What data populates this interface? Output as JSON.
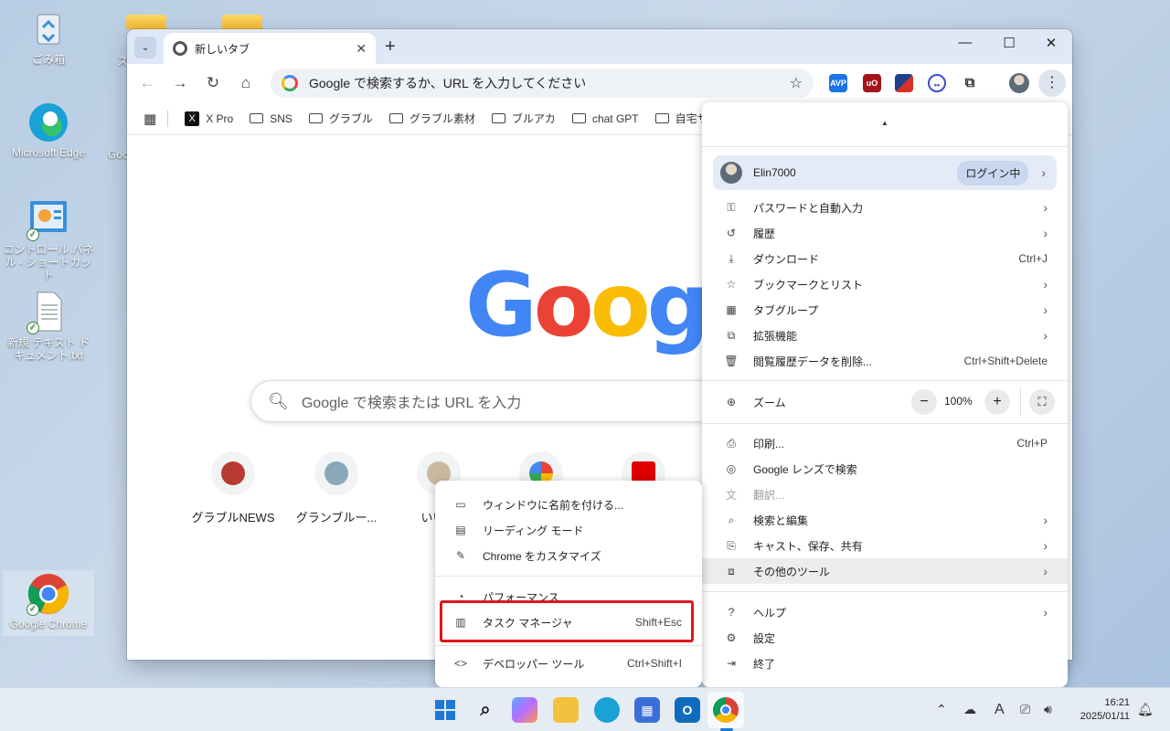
{
  "desktop": {
    "icons": [
      {
        "label": "ごみ箱",
        "icon": "recycle-bin-icon"
      },
      {
        "label": "Microsoft Edge",
        "icon": "edge-icon"
      },
      {
        "label": "コントロール パネル - ショートカット",
        "icon": "control-panel-icon"
      },
      {
        "label": "新規 テキスト ドキュメント.txt",
        "icon": "text-file-icon"
      },
      {
        "label": "Google Chrome",
        "icon": "chrome-icon"
      }
    ],
    "partial_labels": [
      "ス",
      "Goo"
    ]
  },
  "browser": {
    "tab_title": "新しいタブ",
    "omnibox_placeholder": "Google で検索するか、URL を入力してください",
    "bookmarks": [
      {
        "label": "X Pro",
        "icon": "x-icon"
      },
      {
        "label": "SNS",
        "icon": "folder-icon"
      },
      {
        "label": "グラブル",
        "icon": "folder-icon"
      },
      {
        "label": "グラブル素材",
        "icon": "folder-icon"
      },
      {
        "label": "ブルアカ",
        "icon": "folder-icon"
      },
      {
        "label": "chat GPT",
        "icon": "folder-icon"
      },
      {
        "label": "自宅サーバ",
        "icon": "folder-icon"
      }
    ],
    "extensions": [
      {
        "name": "avp-extension-icon",
        "label": "AVP",
        "color": "#1a73e8"
      },
      {
        "name": "ublock-icon",
        "label": "uO",
        "color": "#a3141a"
      },
      {
        "name": "slash-extension-icon",
        "label": "",
        "color": "#d93025"
      },
      {
        "name": "face-extension-icon",
        "label": "",
        "color": "#3c4ccf"
      }
    ]
  },
  "page": {
    "logo": "Google",
    "search_placeholder": "Google で検索または URL を入力",
    "shortcuts": [
      {
        "label": "グラブルNEWS",
        "color": "#b93a32"
      },
      {
        "label": "グランブルー...",
        "color": "#8aa9b8"
      },
      {
        "label": "いいブ",
        "color": "#c9b9a0"
      },
      {
        "label": "",
        "color": "#4285f4"
      },
      {
        "label": "",
        "color": "#e00000"
      }
    ]
  },
  "main_menu": {
    "profile_name": "Elin7000",
    "profile_status": "ログイン中",
    "items_group1": [
      {
        "label": "パスワードと自動入力",
        "icon": "key-icon",
        "shortcut": "",
        "arrow": true
      },
      {
        "label": "履歴",
        "icon": "history-icon",
        "shortcut": "",
        "arrow": true
      },
      {
        "label": "ダウンロード",
        "icon": "download-icon",
        "shortcut": "Ctrl+J",
        "arrow": false
      },
      {
        "label": "ブックマークとリスト",
        "icon": "star-icon",
        "shortcut": "",
        "arrow": true
      },
      {
        "label": "タブグループ",
        "icon": "tab-groups-icon",
        "shortcut": "",
        "arrow": true
      },
      {
        "label": "拡張機能",
        "icon": "extension-icon",
        "shortcut": "",
        "arrow": true
      },
      {
        "label": "閲覧履歴データを削除...",
        "icon": "trash-icon",
        "shortcut": "Ctrl+Shift+Delete",
        "arrow": false
      }
    ],
    "zoom_label": "ズーム",
    "zoom_value": "100%",
    "items_group2": [
      {
        "label": "印刷...",
        "icon": "print-icon",
        "shortcut": "Ctrl+P",
        "arrow": false
      },
      {
        "label": "Google レンズで検索",
        "icon": "lens-icon",
        "shortcut": "",
        "arrow": false
      },
      {
        "label": "翻訳...",
        "icon": "translate-icon",
        "shortcut": "",
        "arrow": false
      },
      {
        "label": "検索と編集",
        "icon": "find-edit-icon",
        "shortcut": "",
        "arrow": true
      },
      {
        "label": "キャスト、保存、共有",
        "icon": "cast-icon",
        "shortcut": "",
        "arrow": true
      },
      {
        "label": "その他のツール",
        "icon": "toolbox-icon",
        "shortcut": "",
        "arrow": true
      }
    ],
    "items_group3": [
      {
        "label": "ヘルプ",
        "icon": "help-icon",
        "shortcut": "",
        "arrow": true
      },
      {
        "label": "設定",
        "icon": "settings-icon",
        "shortcut": "",
        "arrow": false
      },
      {
        "label": "終了",
        "icon": "exit-icon",
        "shortcut": "",
        "arrow": false
      }
    ]
  },
  "sub_menu": {
    "items_group1": [
      {
        "label": "ウィンドウに名前を付ける...",
        "icon": "window-icon",
        "shortcut": ""
      },
      {
        "label": "リーディング モード",
        "icon": "reading-mode-icon",
        "shortcut": ""
      },
      {
        "label": "Chrome をカスタマイズ",
        "icon": "pencil-icon",
        "shortcut": ""
      }
    ],
    "items_group2": [
      {
        "label": "パフォーマンス",
        "icon": "performance-icon",
        "shortcut": ""
      },
      {
        "label": "タスク マネージャ",
        "icon": "task-manager-icon",
        "shortcut": "Shift+Esc"
      }
    ],
    "items_group3": [
      {
        "label": "デベロッパー ツール",
        "icon": "code-icon",
        "shortcut": "Ctrl+Shift+I"
      }
    ]
  },
  "taskbar": {
    "time": "16:21",
    "date": "2025/01/11",
    "ime": "A"
  }
}
